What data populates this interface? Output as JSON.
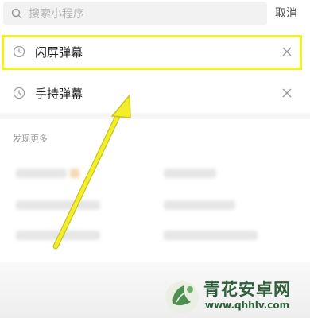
{
  "search": {
    "placeholder": "搜索小程序",
    "cancel_label": "取消"
  },
  "history": [
    {
      "label": "闪屏弹幕",
      "icon": "clock-icon",
      "highlighted": true
    },
    {
      "label": "手持弹幕",
      "icon": "clock-icon",
      "highlighted": false
    }
  ],
  "discover": {
    "title": "发现更多"
  },
  "annotation": {
    "highlight_color": "#f2ee2a",
    "arrow_color": "#f2ee2a"
  },
  "watermark": {
    "title": "青花安卓网",
    "url": "www.qhhlv.com",
    "brand_color": "#2e5e3a"
  }
}
